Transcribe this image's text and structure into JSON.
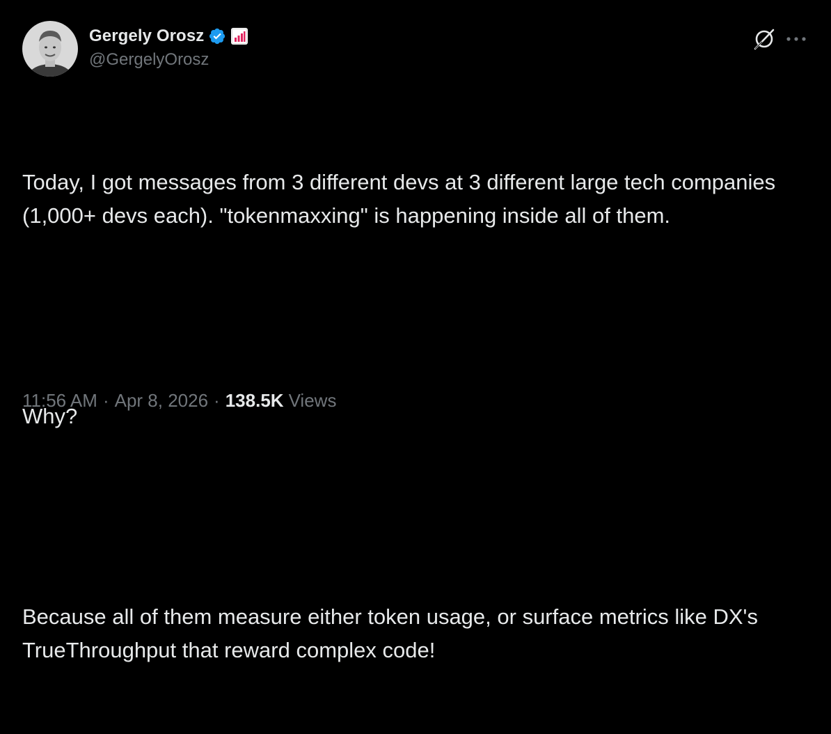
{
  "author": {
    "display_name": "Gergely Orosz",
    "handle": "@GergelyOrosz",
    "avatar_icon": "profile-photo",
    "verified_icon": "verified-badge-icon",
    "affiliation_icon": "affiliation-badge-icon"
  },
  "actions": {
    "grok_icon": "grok-icon",
    "more_icon": "more-icon"
  },
  "post": {
    "paragraph_1": "Today, I got messages from 3 different devs at 3 different large tech companies (1,000+ devs each). \"tokenmaxxing\" is happening inside all of them.",
    "paragraph_2": "Why?",
    "paragraph_3": "Because all of them measure either token usage, or surface metrics like DX's TrueThroughput that reward complex code!"
  },
  "meta": {
    "time": "11:56 AM",
    "separator": "·",
    "date": "Apr 8, 2026",
    "views_count": "138.5K",
    "views_label": "Views"
  },
  "colors": {
    "background": "#000000",
    "text_primary": "#e7e9ea",
    "text_secondary": "#71767b",
    "verified_blue": "#1d9bf0",
    "affiliation_red": "#e0245e"
  }
}
